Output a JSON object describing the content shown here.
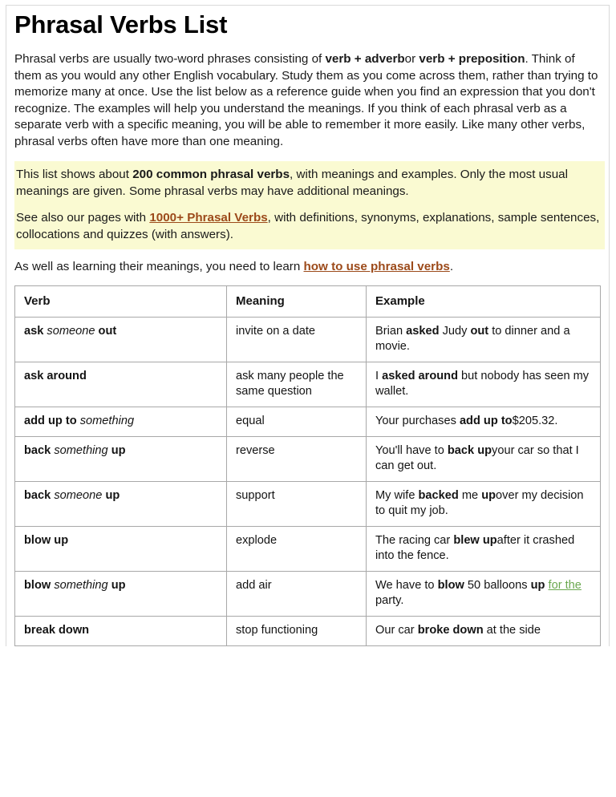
{
  "page": {
    "title": "Phrasal Verbs List"
  },
  "intro": {
    "paragraph": [
      "Phrasal verbs are usually two-word phrases consisting of ",
      "verb + adverb",
      "or ",
      "verb + preposition",
      ". Think of them as you would any other English vocabulary. Study them as you come across them, rather than trying to memorize many at once. Use the list below as a reference guide when you find an expression that you don't recognize. The examples will help you understand the meanings. If you think of each phrasal verb as a separate verb with a specific meaning, you will be able to remember it more easily. Like many other verbs, phrasal verbs often have more than one meaning."
    ]
  },
  "note": {
    "line1_a": "This list shows about ",
    "line1_strong": "200 common phrasal verbs",
    "line1_b": ", with meanings and examples. Only the most usual meanings are given. Some phrasal verbs may have additional meanings.",
    "line2_a": "See also our pages with ",
    "line2_link": "1000+ Phrasal Verbs",
    "line2_b": ", with definitions, synonyms, explanations, sample sentences, collocations and quizzes (with answers)."
  },
  "lead": {
    "text_a": "As well as learning their meanings, you need to learn ",
    "link": "how to use phrasal verbs",
    "text_b": "."
  },
  "table": {
    "headers": {
      "verb": "Verb",
      "meaning": "Meaning",
      "example": "Example"
    },
    "rows": [
      {
        "verb": {
          "b1": "ask",
          "i1": "someone",
          "b2": "out"
        },
        "meaning": "invite on a date",
        "example": {
          "t1": "Brian ",
          "b1": "asked",
          "t2": " Judy ",
          "b2": "out",
          "t3": " to dinner and a movie."
        }
      },
      {
        "verb": {
          "b1": "ask around",
          "i1": "",
          "b2": ""
        },
        "meaning": "ask many people the same question",
        "example": {
          "t1": "I ",
          "b1": "asked around",
          "t2": " but nobody has seen my wallet.",
          "b2": "",
          "t3": ""
        }
      },
      {
        "verb": {
          "b1": "add up to",
          "i1": "something",
          "b2": ""
        },
        "meaning": "equal",
        "example": {
          "t1": "Your purchases ",
          "b1": "add up to",
          "t2": "$205.32.",
          "b2": "",
          "t3": ""
        }
      },
      {
        "verb": {
          "b1": "back",
          "i1": "something",
          "b2": "up"
        },
        "meaning": "reverse",
        "example": {
          "t1": "You'll have to ",
          "b1": "back up",
          "t2": "your car so that I can get out.",
          "b2": "",
          "t3": ""
        }
      },
      {
        "verb": {
          "b1": "back",
          "i1": "someone",
          "b2": "up"
        },
        "meaning": "support",
        "example": {
          "t1": "My wife ",
          "b1": "backed",
          "t2": " me ",
          "b2": "up",
          "t3": "over my decision to quit my job."
        }
      },
      {
        "verb": {
          "b1": "blow up",
          "i1": "",
          "b2": ""
        },
        "meaning": "explode",
        "example": {
          "t1": "The racing car ",
          "b1": "blew up",
          "t2": "after it crashed into the fence.",
          "b2": "",
          "t3": ""
        }
      },
      {
        "verb": {
          "b1": "blow",
          "i1": "something",
          "b2": "up"
        },
        "meaning": "add air",
        "example_special": {
          "t1": "We have to ",
          "b1": "blow",
          "t2": " 50 balloons ",
          "b2": "up",
          "t3": " ",
          "link": "for the",
          "t4": " party."
        }
      },
      {
        "verb": {
          "b1": "break down",
          "i1": "",
          "b2": ""
        },
        "meaning": "stop functioning",
        "example": {
          "t1": "Our car ",
          "b1": "broke down",
          "t2": " at the side",
          "b2": "",
          "t3": ""
        }
      }
    ]
  },
  "colors": {
    "highlight": "#fafad2",
    "link_brown": "#9c4a1a",
    "link_green": "#6aa84f",
    "table_border": "#a8a8a8"
  }
}
